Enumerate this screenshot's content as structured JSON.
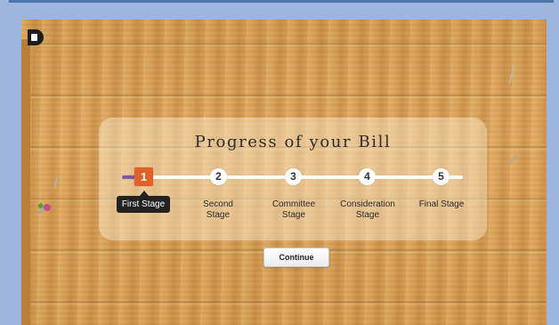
{
  "panel": {
    "title": "Progress of your Bill"
  },
  "progress": {
    "current_step": 1,
    "total_steps": 5
  },
  "steps": [
    {
      "number": "1",
      "label": "First Stage"
    },
    {
      "number": "2",
      "label": "Second Stage"
    },
    {
      "number": "3",
      "label": "Committee Stage"
    },
    {
      "number": "4",
      "label": "Consideration Stage"
    },
    {
      "number": "5",
      "label": "Final Stage"
    }
  ],
  "actions": {
    "continue_label": "Continue"
  },
  "colors": {
    "active_step": "#e3602a",
    "progress_fill": "#7a58a8",
    "frame": "#9db5dd"
  }
}
